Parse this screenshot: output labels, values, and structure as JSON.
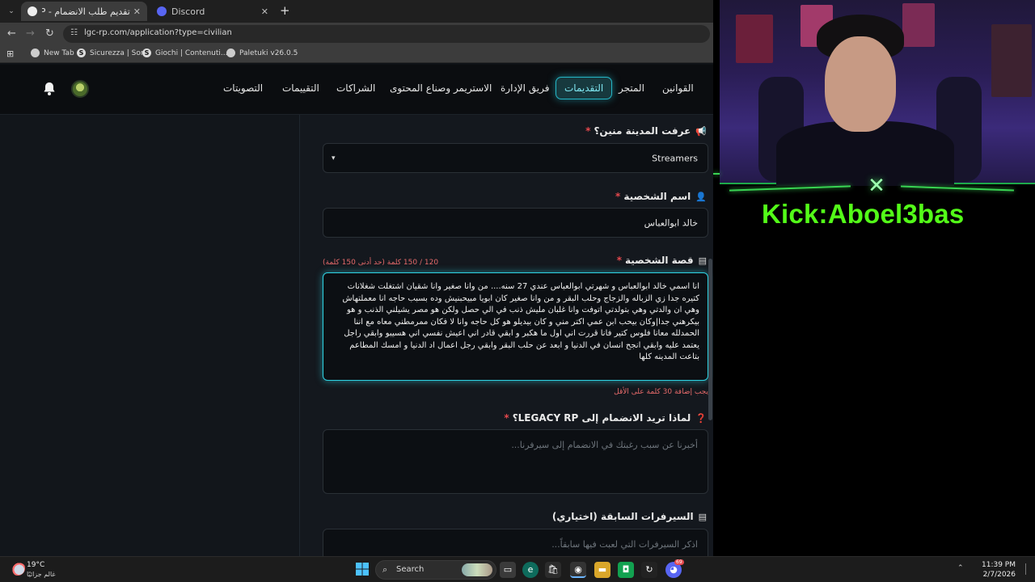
{
  "browser": {
    "tabs": [
      {
        "title": "تقديم طلب الانضمام - LEGACY RP",
        "active": true
      },
      {
        "title": "Discord",
        "active": false
      }
    ],
    "url": "lgc-rp.com/application?type=civilian",
    "bookmarks": [
      "New Tab",
      "Sicurezza | Sony",
      "Giochi | Contenuti...",
      "Paletuki v26.0.5"
    ]
  },
  "site": {
    "nav": [
      "القوانين",
      "المتجر",
      "التقديمات",
      "فريق الإدارة",
      "الاستريمر وصناع المحتوى",
      "الشراكات",
      "التقييمات",
      "التصويتات"
    ],
    "active_nav": "التقديمات",
    "form": {
      "source_label": "عرفت المدينة منين؟",
      "source_value": "Streamers",
      "char_name_label": "اسم الشخصية",
      "char_name_value": "خالد ابوالعباس",
      "story_label": "قصة الشخصية",
      "word_counter": "120 / 150 كلمة (حد أدنى 150 كلمة)",
      "story_text": "انا اسمي خالد ابوالعباس و شهرتي ابوالعباس  عندي 27 سنه....  من وانا صغير وانا شقيان اشتغلت شغلانات كتيره جدا زي الزباله والزجاج  وحلب البقر  و من وانا صغير كان ابويا مبيحبنيش وده بسبب حاجه انا معملتهاش وهي ان والدتي وهي بتولدتي اتوفت وانا غلبان مليش ذنب في الي حصل ولكن هو مصر يشيلني الذنب و هو بيكرهني جدا|وكان بيحب ابن عمي اكتر مني و كان بيديلو هو كل حاجه وانا لا فكان ممرمطني معاه مع اننا الحمدلله معانا فلوس كتير فانا قررت اني اول ما هكبر و ابقي قادر اني اعيش نفسي اني هسيبو وابقي راجل يعتمد عليه وابقي انجح  انسان في الدنيا و ابعد عن  حلب البقر وابقي رجل اعمال اد الدنيا و امسك المطاعم بتاعت المدينه كلها",
      "story_warning": "يجب إضافة 30 كلمة على الأقل",
      "why_join_label": "لماذا تريد الانضمام إلى LEGACY RP؟",
      "why_join_placeholder": "أخبرنا عن سبب رغبتك في الانضمام إلى سيرفرنا...",
      "prev_servers_label": "السيرفرات السابقة (اختياري)",
      "prev_servers_placeholder": "اذكر السيرفرات التي لعبت فيها سابقاً..."
    }
  },
  "stream": {
    "kick_text": "Kick:Aboel3bas",
    "accent": "#53fc18"
  },
  "taskbar": {
    "temperature": "19°C",
    "weather": "غالم جزائيًا",
    "search": "Search",
    "time": "11:39 PM",
    "date": "2/7/2026",
    "badge": "69"
  },
  "colors": {
    "cyan_accent": "#2fd3e3",
    "required_star": "#e5484d",
    "warning": "#e56a6a"
  }
}
